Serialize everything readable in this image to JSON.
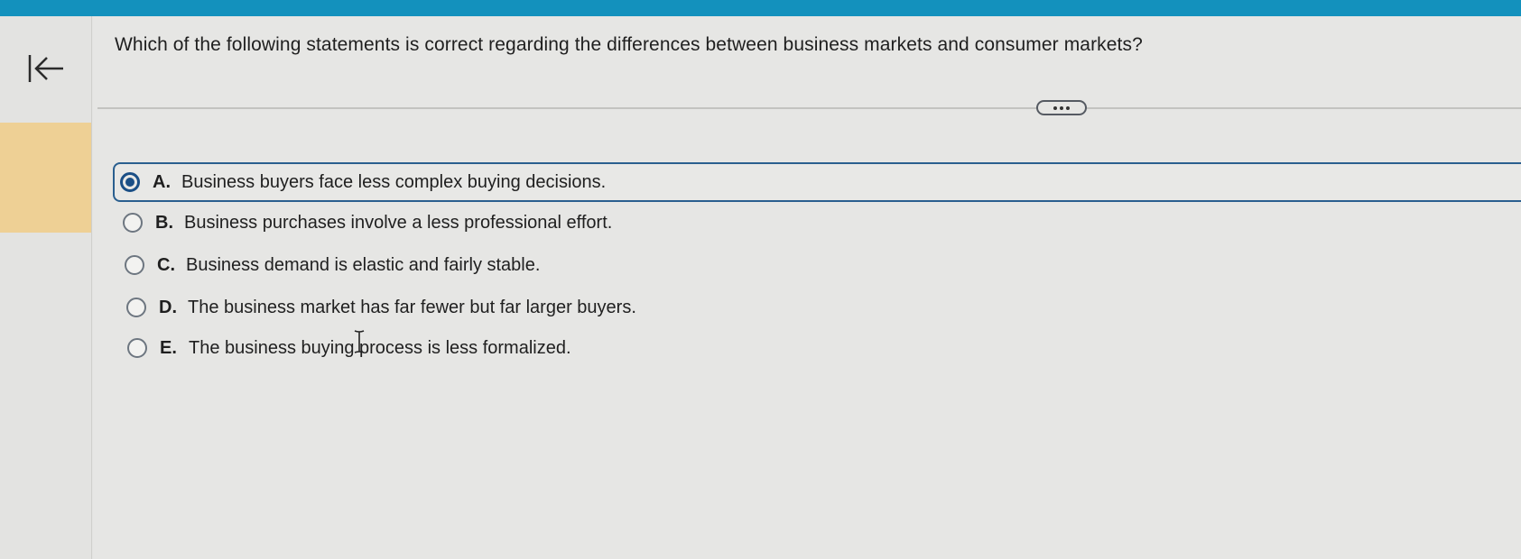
{
  "question": "Which of the following statements is correct regarding the differences between business markets and consumer markets?",
  "options": [
    {
      "letter": "A.",
      "text": "Business buyers face less complex buying decisions.",
      "selected": true
    },
    {
      "letter": "B.",
      "text": "Business purchases involve a less professional effort.",
      "selected": false
    },
    {
      "letter": "C.",
      "text": "Business demand is elastic and fairly stable.",
      "selected": false
    },
    {
      "letter": "D.",
      "text": "The business market has far fewer but far larger buyers.",
      "selected": false
    },
    {
      "letter": "E.",
      "text": "The business buying process is less formalized.",
      "selected": false
    }
  ],
  "icons": {
    "back": "back-to-start-icon",
    "more": "more-options-icon",
    "cursor": "text-cursor-icon"
  },
  "colors": {
    "top_bar": "#1391bd",
    "rail_highlight": "#eed095",
    "selected_accent": "#1b4f86"
  }
}
